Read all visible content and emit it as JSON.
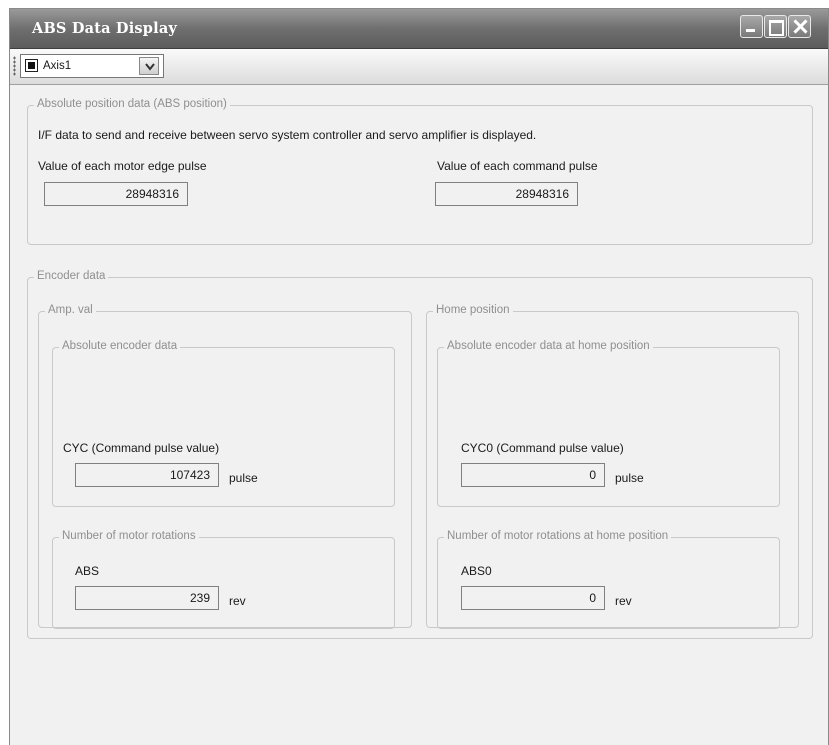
{
  "window": {
    "title": "ABS Data Display"
  },
  "toolbar": {
    "axis_selected": "Axis1",
    "axis_options": [
      "Axis1"
    ]
  },
  "abs_position": {
    "legend": "Absolute position data (ABS position)",
    "description": "I/F data to send and receive between servo system controller and servo amplifier is displayed.",
    "motor_edge_label": "Value of each motor edge pulse",
    "motor_edge_value": "28948316",
    "command_pulse_label": "Value of each command pulse",
    "command_pulse_value": "28948316"
  },
  "encoder": {
    "legend": "Encoder data",
    "amp": {
      "legend": "Amp. val",
      "abs_encoder_legend": "Absolute encoder data",
      "cyc_label": "CYC (Command pulse value)",
      "cyc_value": "107423",
      "cyc_unit": "pulse",
      "rotations_legend": "Number of motor rotations",
      "abs_label": "ABS",
      "abs_value": "239",
      "abs_unit": "rev"
    },
    "home": {
      "legend": "Home position",
      "abs_encoder_legend": "Absolute encoder data at home position",
      "cyc_label": "CYC0 (Command pulse value)",
      "cyc_value": "0",
      "cyc_unit": "pulse",
      "rotations_legend": "Number of motor rotations at home position",
      "abs_label": "ABS0",
      "abs_value": "0",
      "abs_unit": "rev"
    }
  }
}
